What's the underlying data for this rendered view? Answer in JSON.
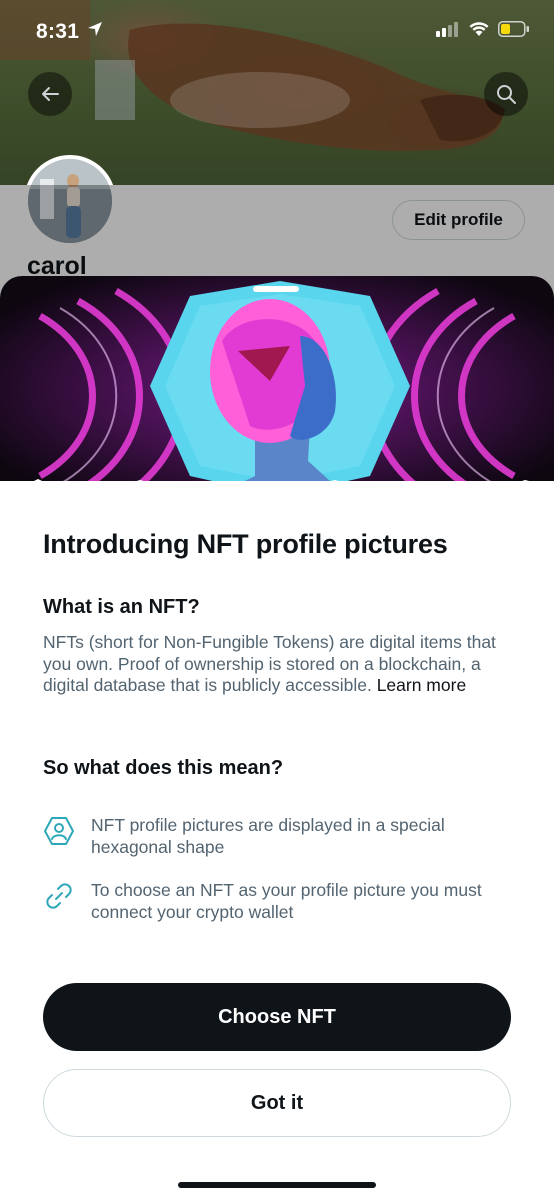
{
  "status_bar": {
    "time": "8:31"
  },
  "profile": {
    "name": "carol",
    "edit_profile_label": "Edit profile"
  },
  "sheet": {
    "title": "Introducing NFT profile pictures",
    "what_heading": "What is an NFT?",
    "what_body": "NFTs (short for Non-Fungible Tokens) are digital items that you own. Proof of ownership is stored on a blockchain, a digital database that is publicly accessible.",
    "learn_more": "Learn more",
    "meaning_heading": "So what does this mean?",
    "features": [
      {
        "icon": "hexagon-profile-icon",
        "text": "NFT profile pictures are displayed in a special hexagonal shape"
      },
      {
        "icon": "link-icon",
        "text": "To choose an NFT as your profile picture you must connect your crypto wallet"
      }
    ],
    "primary_button": "Choose NFT",
    "secondary_button": "Got it"
  },
  "colors": {
    "primary_text": "#0f1419",
    "secondary_text": "#536471",
    "icon_teal": "#2ea7b8",
    "hero_magenta": "#e23bd3",
    "hero_cyan": "#59d6ee",
    "border": "#cfd9de"
  }
}
